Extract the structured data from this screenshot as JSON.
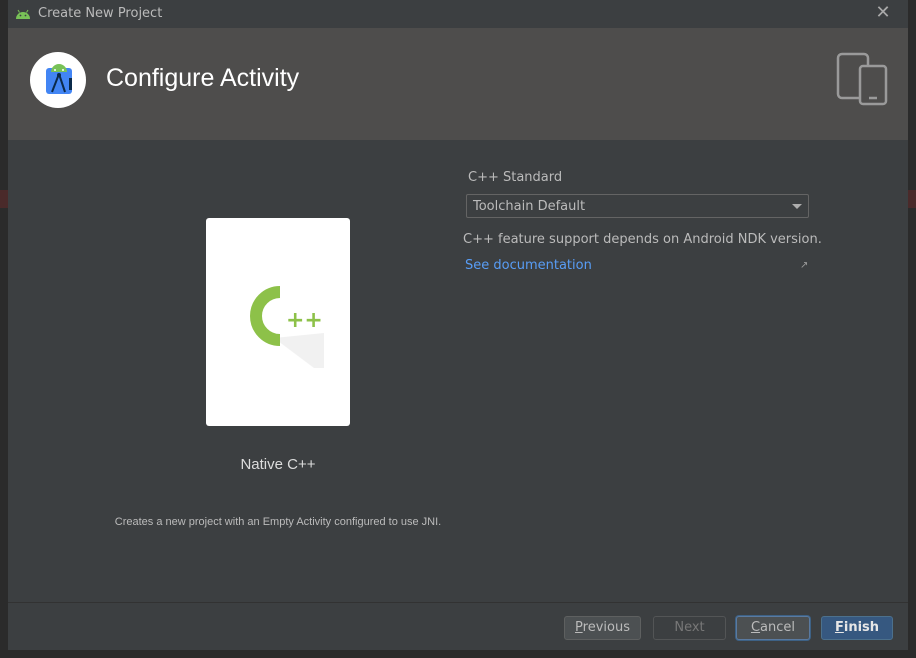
{
  "window": {
    "title": "Create New Project",
    "close_glyph": "✕"
  },
  "header": {
    "title": "Configure Activity",
    "logo_icon": "android-studio-logo-icon",
    "right_icon": "devices-icon"
  },
  "template": {
    "name": "Native C++",
    "description": "Creates a new project with an Empty Activity configured to use JNI.",
    "icon": "cpp-icon"
  },
  "form": {
    "cpp_standard_label": "C++ Standard",
    "cpp_standard_value": "Toolchain Default",
    "info_text": "C++ feature support depends on Android NDK version.",
    "doc_link": "See documentation",
    "doc_link_icon": "↗"
  },
  "buttons": {
    "previous_underline": "P",
    "previous_rest": "revious",
    "next": "Next",
    "cancel_underline": "C",
    "cancel_rest": "ancel",
    "finish_underline": "F",
    "finish_rest": "inish"
  },
  "colors": {
    "accent_link": "#589df6",
    "primary_button": "#365880",
    "cpp_green": "#8dc149"
  }
}
